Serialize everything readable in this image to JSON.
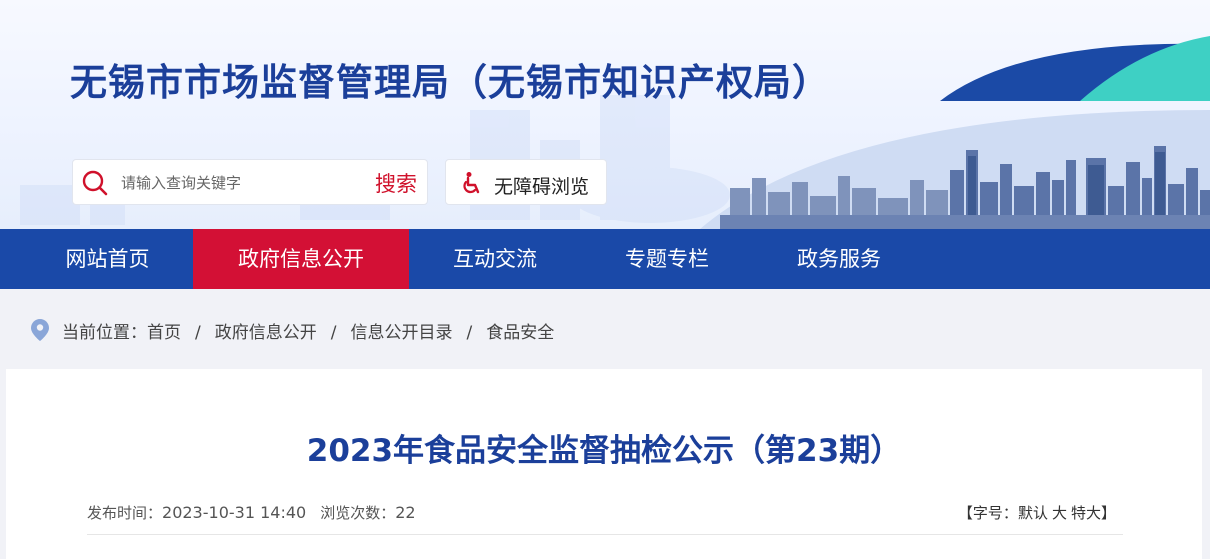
{
  "header": {
    "site_title": "无锡市市场监督管理局（无锡市知识产权局）",
    "search": {
      "placeholder": "请输入查询关键字",
      "button_label": "搜索",
      "icon": "search-icon"
    },
    "accessibility": {
      "label": "无障碍浏览",
      "icon": "wheelchair-icon"
    }
  },
  "nav": {
    "items": [
      {
        "label": "网站首页"
      },
      {
        "label": "政府信息公开",
        "active": true
      },
      {
        "label": "互动交流"
      },
      {
        "label": "专题专栏"
      },
      {
        "label": "政务服务"
      }
    ]
  },
  "breadcrumb": {
    "prefix": "当前位置：",
    "items": [
      "首页",
      "政府信息公开",
      "信息公开目录",
      "食品安全"
    ],
    "separator": "/",
    "icon": "location-pin-icon"
  },
  "article": {
    "title": "2023年食品安全监督抽检公示（第23期）",
    "publish_label": "发布时间：",
    "publish_time": "2023-10-31 14:40",
    "views_label": "浏览次数：",
    "views": "22",
    "font_size": {
      "open": "【",
      "label": "字号：",
      "options": [
        "默认",
        "大",
        "特大"
      ],
      "close": "】"
    }
  },
  "colors": {
    "brand_blue": "#1a49a8",
    "title_blue": "#1b3f9a",
    "active_red": "#d31035",
    "search_red": "#d0112b"
  }
}
